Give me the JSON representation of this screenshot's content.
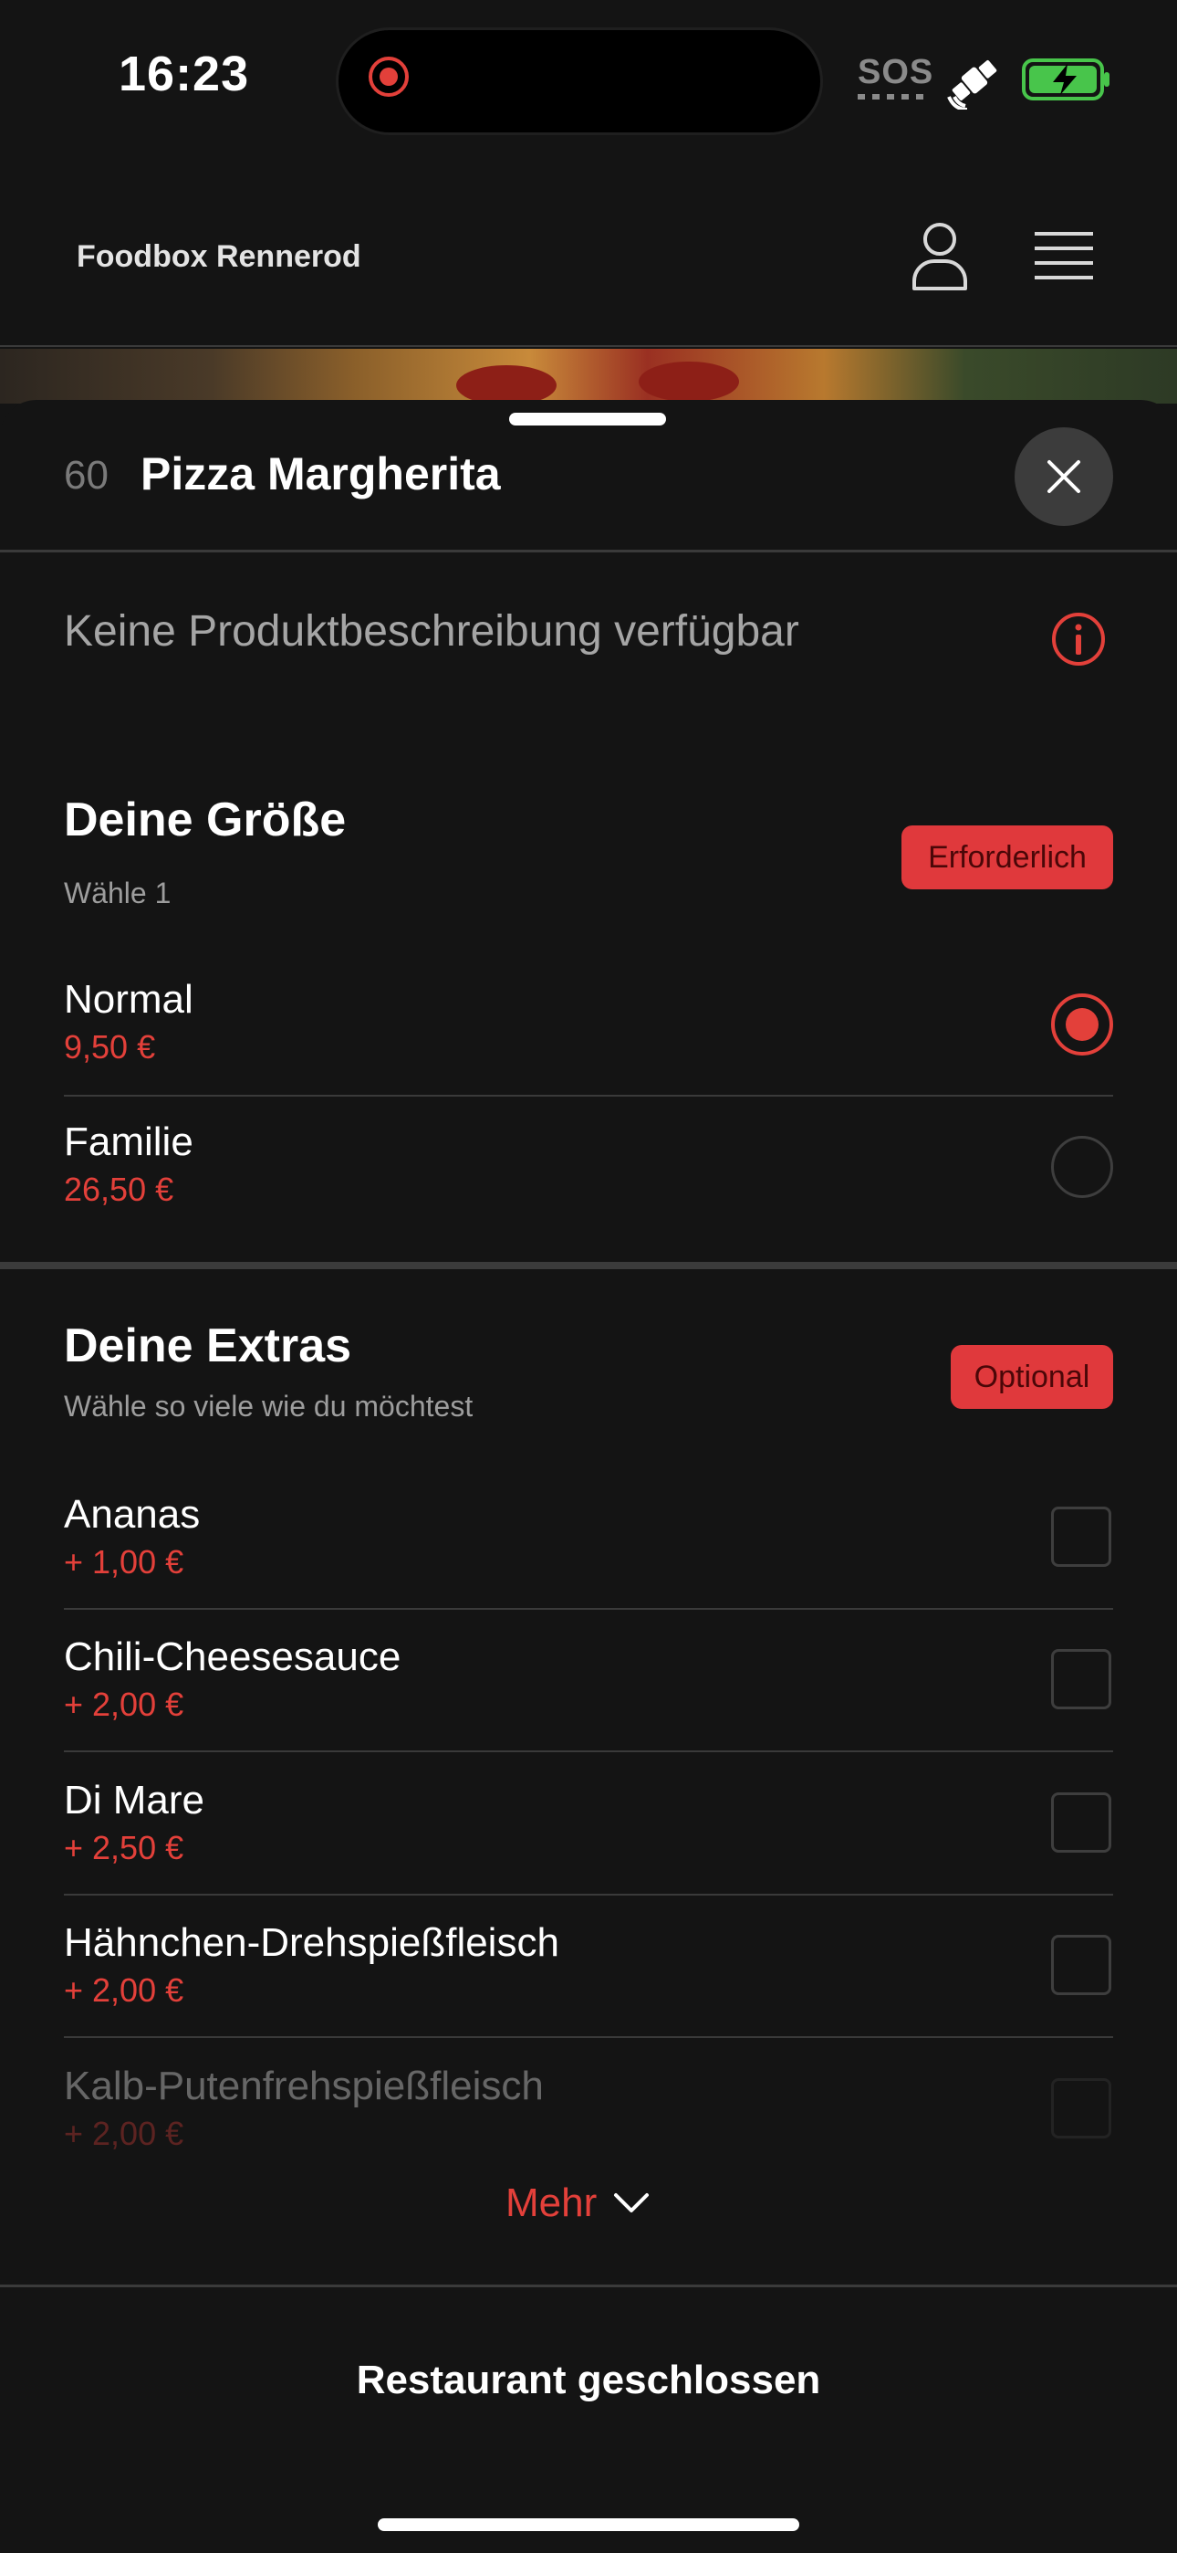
{
  "status_bar": {
    "time": "16:23",
    "icons": [
      "screen-record-icon",
      "sos-icon",
      "satellite-icon",
      "battery-charging-icon"
    ],
    "sos_text": "SOS"
  },
  "header": {
    "brand": "Foodbox Rennerod",
    "icons": [
      "user-icon",
      "hamburger-menu-icon"
    ]
  },
  "product": {
    "number": "60",
    "name": "Pizza Margherita",
    "description": "Keine Produktbeschreibung verfügbar"
  },
  "size_group": {
    "title": "Deine Größe",
    "subtitle": "Wähle 1",
    "badge": "Erforderlich",
    "options": [
      {
        "name": "Normal",
        "price": "9,50 €",
        "selected": true
      },
      {
        "name": "Familie",
        "price": "26,50 €",
        "selected": false
      }
    ]
  },
  "extras_group": {
    "title": "Deine Extras",
    "subtitle": "Wähle so viele wie du möchtest",
    "badge": "Optional",
    "options": [
      {
        "name": "Ananas",
        "price": "+ 1,00 €",
        "checked": false
      },
      {
        "name": "Chili-Cheesesauce",
        "price": "+ 2,00 €",
        "checked": false
      },
      {
        "name": "Di Mare",
        "price": "+ 2,50 €",
        "checked": false
      },
      {
        "name": "Hähnchen-Drehspießfleisch",
        "price": "+ 2,00 €",
        "checked": false
      },
      {
        "name": "Kalb-Putenfrehspießfleisch",
        "price": "+ 2,00 €",
        "checked": false
      }
    ]
  },
  "more_label": "Mehr",
  "footer": {
    "label": "Restaurant geschlossen"
  },
  "colors": {
    "accent": "#e3403a",
    "badge_bg": "#e0393c",
    "background": "#141414",
    "divider": "#3a3a3a"
  }
}
